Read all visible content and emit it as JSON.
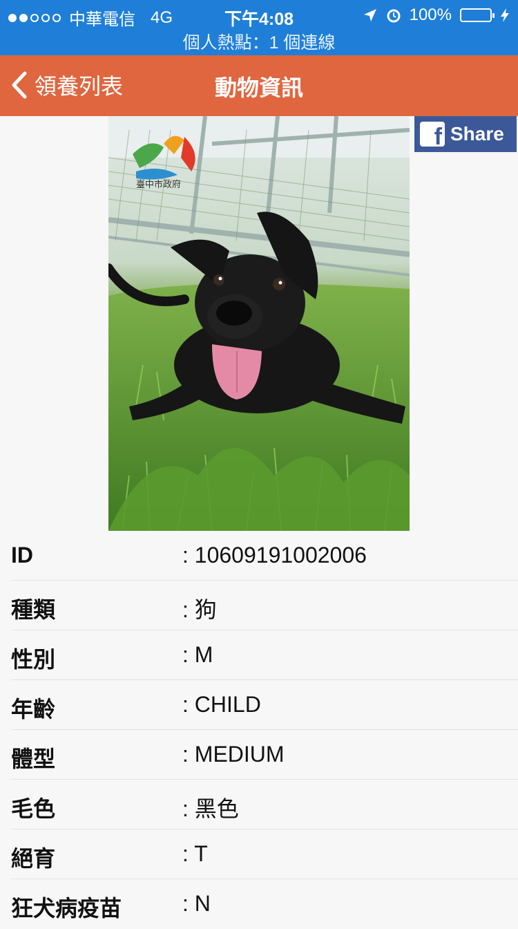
{
  "status_bar": {
    "carrier": "中華電信",
    "network": "4G",
    "time": "下午4:08",
    "battery": "100%",
    "hotspot": "個人熱點：1 個連線"
  },
  "nav": {
    "back_label": "領養列表",
    "title": "動物資訊"
  },
  "photo": {
    "logo_text": "臺中市政府"
  },
  "share": {
    "label": "Share"
  },
  "info": {
    "rows": [
      {
        "label": "ID",
        "value": ": 10609191002006"
      },
      {
        "label": "種類",
        "value": ": 狗"
      },
      {
        "label": "性別",
        "value": ": M"
      },
      {
        "label": "年齡",
        "value": ": CHILD"
      },
      {
        "label": "體型",
        "value": ": MEDIUM"
      },
      {
        "label": "毛色",
        "value": ": 黑色"
      },
      {
        "label": "絕育",
        "value": ": T"
      },
      {
        "label": "狂犬病疫苗",
        "value": ": N"
      }
    ]
  },
  "colors": {
    "status_bar": "#1f7fd8",
    "nav_bar": "#e0663f",
    "facebook": "#3b5998"
  }
}
